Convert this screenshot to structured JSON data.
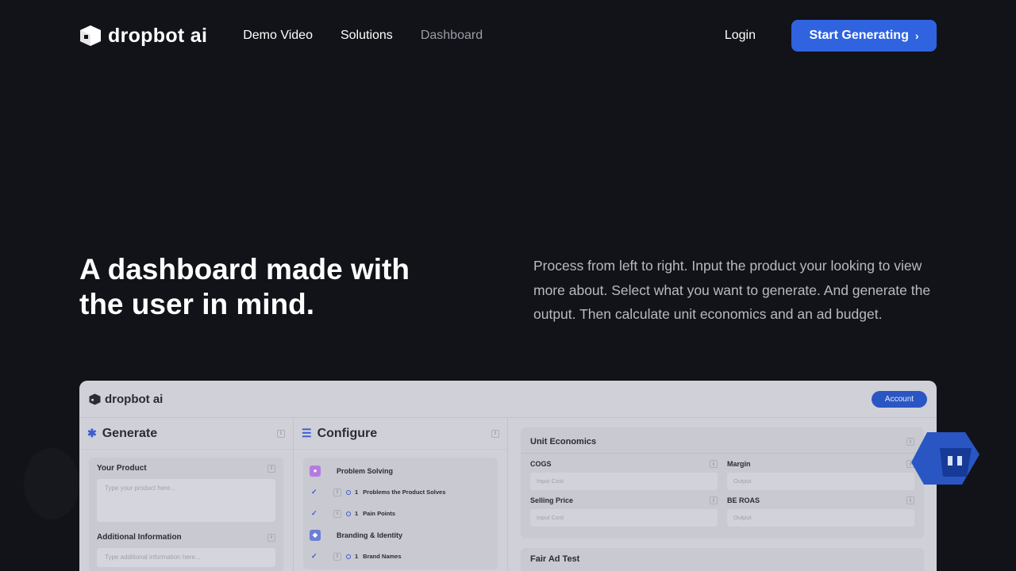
{
  "nav": {
    "brand": "dropbot ai",
    "links": [
      "Demo Video",
      "Solutions",
      "Dashboard"
    ],
    "login": "Login",
    "cta": "Start Generating"
  },
  "hero": {
    "title": "A dashboard made with the user in mind.",
    "description": "Process from left to right. Input the product your looking to view more about. Select what you want to generate. And generate the output. Then calculate unit economics and an ad budget."
  },
  "preview": {
    "brand": "dropbot ai",
    "account": "Account",
    "generate": {
      "title": "Generate",
      "product_label": "Your Product",
      "product_placeholder": "Type your product here...",
      "additional_label": "Additional Information",
      "additional_placeholder": "Type additional information here..."
    },
    "configure": {
      "title": "Configure",
      "group1": "Problem Solving",
      "item1_num": "1",
      "item1": "Problems the Product Solves",
      "item2_num": "1",
      "item2": "Pain Points",
      "group2": "Branding & Identity",
      "item3_num": "1",
      "item3": "Brand Names"
    },
    "unit_economics": {
      "title": "Unit Economics",
      "cogs": "COGS",
      "cogs_placeholder": "Input Cost",
      "margin": "Margin",
      "margin_placeholder": "Output",
      "selling_price": "Selling Price",
      "selling_placeholder": "Input Cost",
      "be_roas": "BE ROAS",
      "be_roas_placeholder": "Output"
    },
    "fair_ad_test": "Fair Ad Test"
  },
  "colors": {
    "background": "#121319",
    "accent": "#2f63df",
    "panel": "#cfd0d8"
  }
}
